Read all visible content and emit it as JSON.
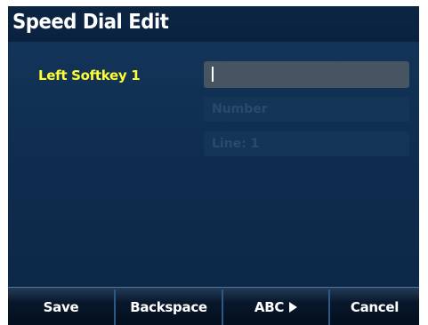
{
  "screen": {
    "title": "Speed Dial Edit",
    "field_label": "Left Softkey 1",
    "fields": {
      "label_value": "",
      "number_placeholder": "Number",
      "line_value": "Line: 1"
    }
  },
  "softkeys": [
    {
      "label": "Save"
    },
    {
      "label": "Backspace"
    },
    {
      "label": "ABC",
      "icon": "right-arrow-icon"
    },
    {
      "label": "Cancel"
    }
  ],
  "colors": {
    "background": "#0f2d4f",
    "title_bar": "#0a2240",
    "label_accent": "#ffff33",
    "active_field": "#465561",
    "inactive_field": "#143555",
    "inactive_text": "#2a4a6c"
  }
}
